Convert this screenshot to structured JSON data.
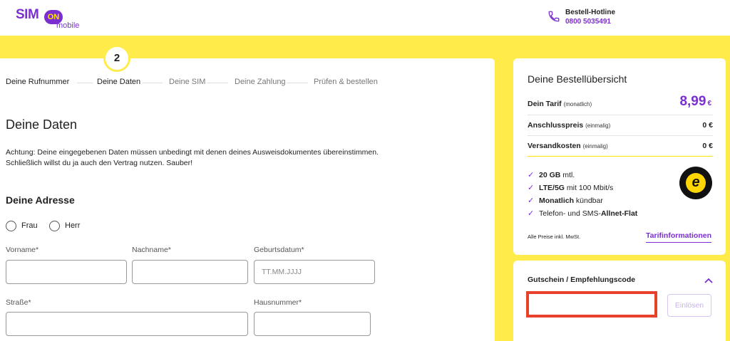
{
  "header": {
    "logo_sim": "SIM",
    "logo_on": "ON",
    "logo_mobile": "mobile",
    "hotline_label": "Bestell-Hotline",
    "hotline_number": "0800 5035491"
  },
  "progress": {
    "current_step_number": "2",
    "steps": [
      {
        "label": "Deine Rufnummer",
        "state": "done"
      },
      {
        "label": "Deine Daten",
        "state": "active"
      },
      {
        "label": "Deine SIM",
        "state": "todo"
      },
      {
        "label": "Deine Zahlung",
        "state": "todo"
      },
      {
        "label": "Prüfen & bestellen",
        "state": "todo"
      }
    ]
  },
  "form": {
    "title": "Deine Daten",
    "warning_line1": "Achtung: Deine eingegebenen Daten müssen unbedingt mit denen deines Ausweisdokumentes übereinstimmen.",
    "warning_line2": "Schließlich willst du ja auch den Vertrag nutzen. Sauber!",
    "address_title": "Deine Adresse",
    "salutation_options": [
      "Frau",
      "Herr"
    ],
    "fields": {
      "vorname_label": "Vorname*",
      "nachname_label": "Nachname*",
      "geburtsdatum_label": "Geburtsdatum*",
      "geburtsdatum_placeholder": "TT.MM.JJJJ",
      "strasse_label": "Straße*",
      "hausnummer_label": "Hausnummer*"
    }
  },
  "summary": {
    "title": "Deine Bestellübersicht",
    "tarif_label": "Dein Tarif",
    "tarif_note": "(monatlich)",
    "tarif_price": "8,99",
    "tarif_currency": "€",
    "anschluss_label": "Anschlusspreis",
    "anschluss_note": "(einmalig)",
    "anschluss_price": "0 €",
    "versand_label": "Versandkosten",
    "versand_note": "(einmalig)",
    "versand_price": "0 €",
    "features": [
      {
        "bold": "20 GB",
        "text": " mtl.",
        "prefix": ""
      },
      {
        "bold": "LTE/5G",
        "text": " mit 100 Mbit/s",
        "prefix": ""
      },
      {
        "bold": "Monatlich",
        "text": " kündbar",
        "prefix": ""
      },
      {
        "bold": "Allnet-Flat",
        "text": "",
        "prefix": "Telefon- und SMS-"
      }
    ],
    "seal_letter": "e",
    "prices_note": "Alle Preise inkl. MwSt.",
    "tarif_link": "Tarifinformationen"
  },
  "voucher": {
    "title": "Gutschein / Empfehlungscode",
    "input_value": "",
    "button_label": "Einlösen"
  },
  "colors": {
    "brand_purple": "#7b2fd0",
    "brand_yellow": "#ffec4a",
    "highlight_red": "#e8412b"
  }
}
